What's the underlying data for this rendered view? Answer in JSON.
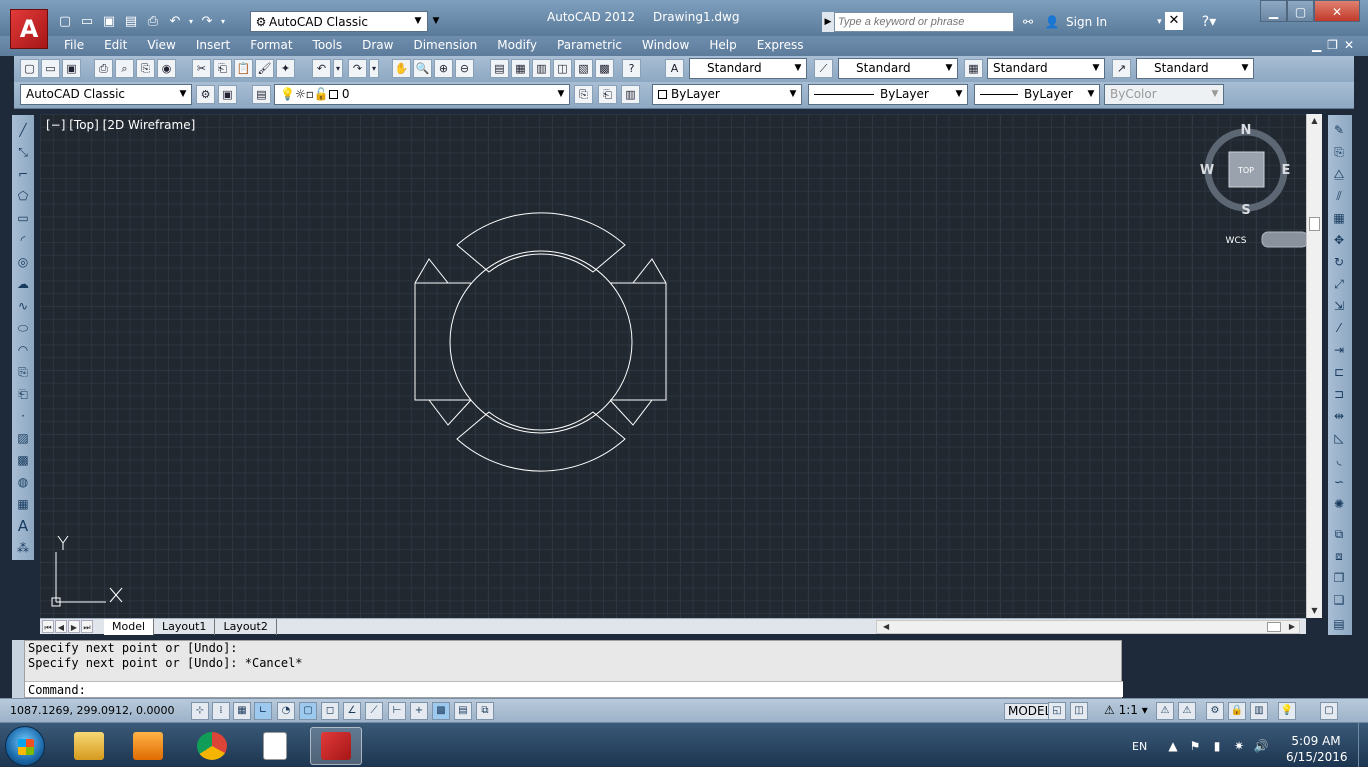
{
  "app": {
    "name": "AutoCAD 2012",
    "document": "Drawing1.dwg",
    "workspace": "AutoCAD Classic",
    "search_placeholder": "Type a keyword or phrase",
    "sign_in": "Sign In"
  },
  "menu": [
    "File",
    "Edit",
    "View",
    "Insert",
    "Format",
    "Tools",
    "Draw",
    "Dimension",
    "Modify",
    "Parametric",
    "Window",
    "Help",
    "Express"
  ],
  "styles_toolbar": {
    "text_style": "Standard",
    "dim_style": "Standard",
    "table_style": "Standard",
    "mleader_style": "Standard"
  },
  "layers_toolbar": {
    "workspace": "AutoCAD Classic",
    "layer": "0",
    "color": "ByLayer",
    "linetype": "ByLayer",
    "lineweight": "ByLayer",
    "plotstyle": "ByColor"
  },
  "viewport": {
    "label": "[−] [Top] [2D Wireframe]"
  },
  "viewcube": {
    "north": "N",
    "south": "S",
    "east": "E",
    "west": "W",
    "face": "TOP",
    "ucs": "WCS"
  },
  "ucs_icon": {
    "x_label": "X",
    "y_label": "Y"
  },
  "tabs": [
    "Model",
    "Layout1",
    "Layout2"
  ],
  "command": {
    "history": [
      "Specify next point or [Undo]:",
      "Specify next point or [Undo]: *Cancel*"
    ],
    "prompt": "Command:"
  },
  "status": {
    "coordinates": "1087.1269, 299.0912, 0.0000",
    "space": "MODEL",
    "annotation_scale": "1:1"
  },
  "taskbar": {
    "language": "EN",
    "time": "5:09 AM",
    "date": "6/15/2016"
  },
  "colors": {
    "canvas": "#212830",
    "drawing_lines": "#ffffff",
    "titlebar": "#6f8eae"
  }
}
